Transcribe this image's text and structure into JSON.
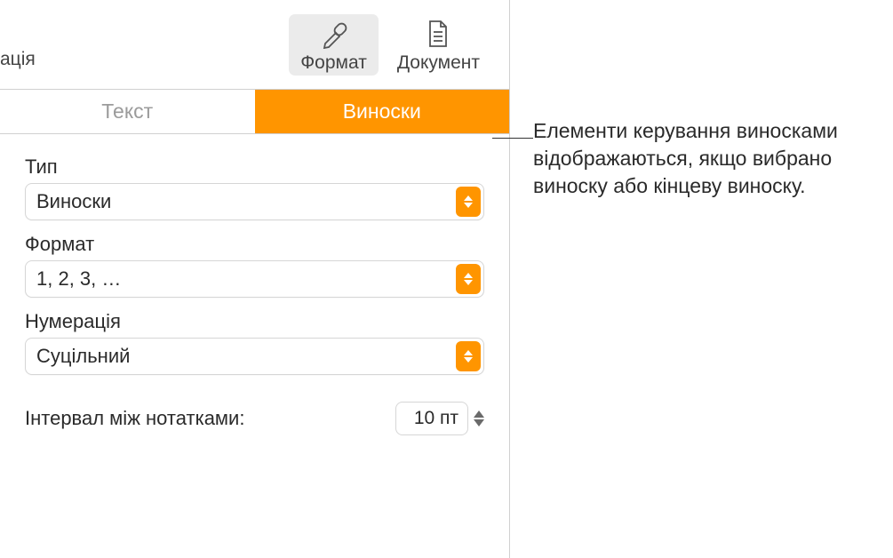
{
  "toolbar": {
    "cutoff_text": "ація",
    "format_label": "Формат",
    "document_label": "Документ"
  },
  "tabs": {
    "text": "Текст",
    "footnotes": "Виноски"
  },
  "fields": {
    "type": {
      "label": "Тип",
      "value": "Виноски"
    },
    "format": {
      "label": "Формат",
      "value": "1, 2, 3, …"
    },
    "numbering": {
      "label": "Нумерація",
      "value": "Суцільний"
    },
    "spacing": {
      "label": "Інтервал між нотатками:",
      "value": "10 пт"
    }
  },
  "callout": "Елементи керування виносками відображаються, якщо вибрано виноску або кінцеву виноску."
}
